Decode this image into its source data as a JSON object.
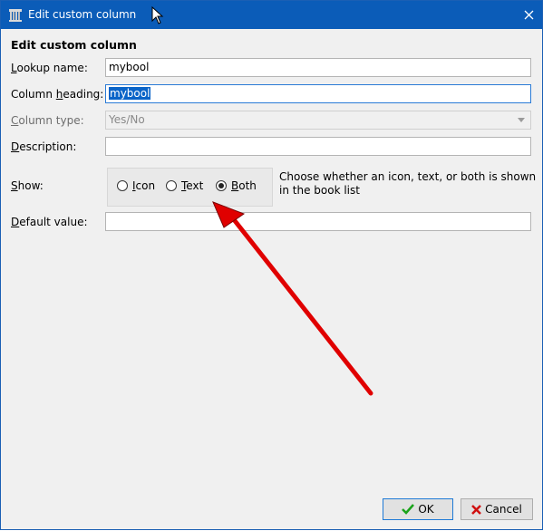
{
  "window": {
    "title": "Edit custom column"
  },
  "form": {
    "section_title": "Edit custom column",
    "lookup_name": {
      "label_acc": "L",
      "label_rest": "ookup name:",
      "value": "mybool"
    },
    "column_heading": {
      "label_pre": "Column ",
      "label_acc": "h",
      "label_rest": "eading:",
      "value": "mybool"
    },
    "column_type": {
      "label_acc": "C",
      "label_rest": "olumn type:",
      "value": "Yes/No"
    },
    "description": {
      "label_acc": "D",
      "label_rest": "escription:",
      "value": ""
    },
    "show": {
      "label_acc": "S",
      "label_rest": "how:",
      "options": [
        {
          "acc": "I",
          "rest": "con",
          "checked": false
        },
        {
          "acc": "T",
          "rest": "ext",
          "checked": false
        },
        {
          "acc": "B",
          "rest": "oth",
          "checked": true
        }
      ],
      "help": "Choose whether an icon, text, or both is shown in the book list"
    },
    "default_value": {
      "label_acc": "D",
      "label_rest": "efault value:",
      "value": ""
    }
  },
  "buttons": {
    "ok": "OK",
    "cancel": "Cancel"
  },
  "colors": {
    "titlebar": "#0b5cb8",
    "annotation_arrow": "#e00000",
    "ok_check": "#1aa31a",
    "cancel_x": "#d01010"
  }
}
